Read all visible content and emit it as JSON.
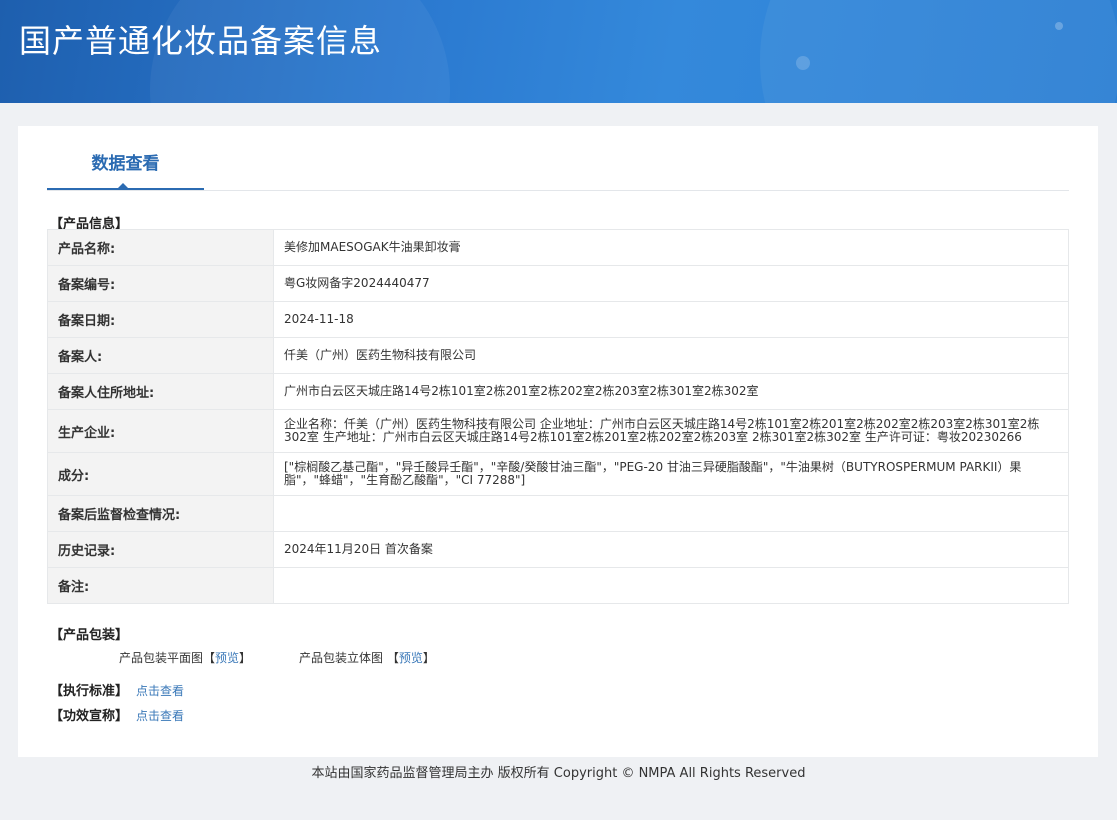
{
  "header": {
    "title": "国产普通化妆品备案信息"
  },
  "tabs": [
    {
      "label": "数据查看"
    }
  ],
  "product_info": {
    "section_title": "【产品信息】",
    "rows": [
      {
        "label": "产品名称:",
        "value": "美修加MAESOGAK牛油果卸妆膏"
      },
      {
        "label": "备案编号:",
        "value": "粤G妆网备字2024440477"
      },
      {
        "label": "备案日期:",
        "value": "2024-11-18"
      },
      {
        "label": "备案人:",
        "value": "仟美（广州）医药生物科技有限公司"
      },
      {
        "label": "备案人住所地址:",
        "value": "广州市白云区天城庄路14号2栋101室2栋201室2栋202室2栋203室2栋301室2栋302室"
      },
      {
        "label": "生产企业:",
        "value": "企业名称：仟美（广州）医药生物科技有限公司 企业地址：广州市白云区天城庄路14号2栋101室2栋201室2栋202室2栋203室2栋301室2栋302室 生产地址：广州市白云区天城庄路14号2栋101室2栋201室2栋202室2栋203室 2栋301室2栋302室 生产许可证：粤妆20230266"
      },
      {
        "label": "成分:",
        "value": "[\"棕榈酸乙基己酯\"，\"异壬酸异壬酯\"，\"辛酸/癸酸甘油三酯\"，\"PEG-20 甘油三异硬脂酸酯\"，\"牛油果树（BUTYROSPERMUM PARKII）果脂\"，\"蜂蜡\"，\"生育酚乙酸酯\"，\"CI 77288\"]"
      },
      {
        "label": "备案后监督检查情况:",
        "value": ""
      },
      {
        "label": "历史记录:",
        "value": "2024年11月20日 首次备案"
      },
      {
        "label": "备注:",
        "value": ""
      }
    ]
  },
  "packaging": {
    "section_title": "【产品包装】",
    "flat_label": "产品包装平面图",
    "solid_label": "产品包装立体图",
    "bracket_open": "【",
    "bracket_close": "】",
    "preview_link": "预览"
  },
  "standard": {
    "label": "【执行标准】",
    "link": "点击查看"
  },
  "efficacy": {
    "label": "【功效宣称】",
    "link": "点击查看"
  },
  "footer": {
    "text": "本站由国家药品监督管理局主办 版权所有 Copyright © NMPA All Rights Reserved"
  }
}
